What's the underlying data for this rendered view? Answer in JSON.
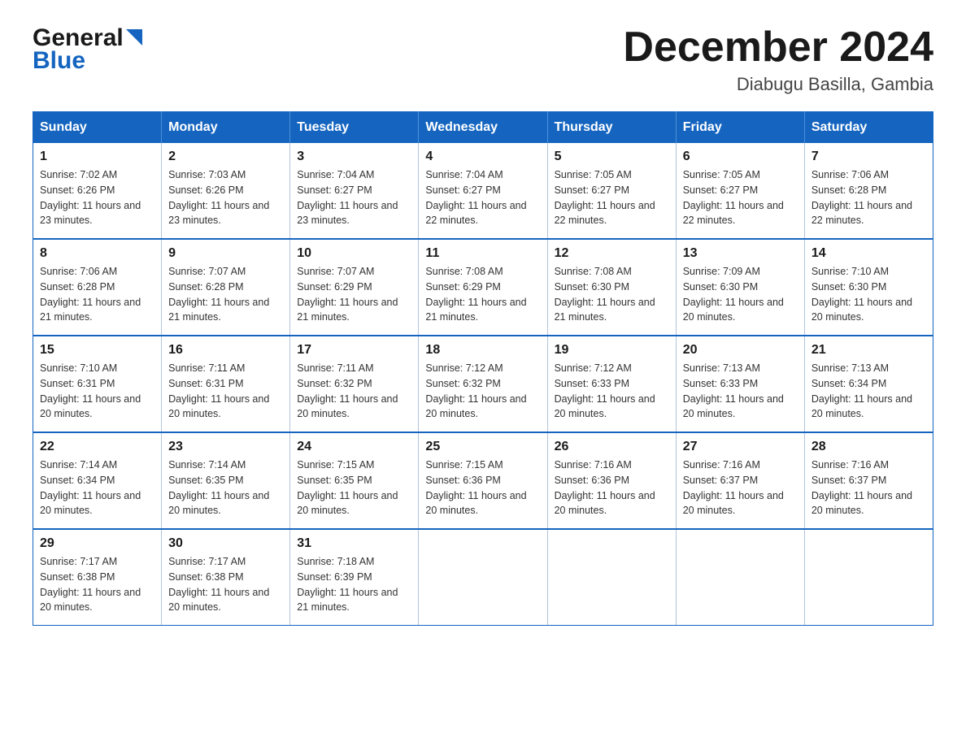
{
  "logo": {
    "general": "General",
    "blue": "Blue"
  },
  "title": "December 2024",
  "location": "Diabugu Basilla, Gambia",
  "headers": [
    "Sunday",
    "Monday",
    "Tuesday",
    "Wednesday",
    "Thursday",
    "Friday",
    "Saturday"
  ],
  "weeks": [
    [
      {
        "day": "1",
        "sunrise": "7:02 AM",
        "sunset": "6:26 PM",
        "daylight": "11 hours and 23 minutes."
      },
      {
        "day": "2",
        "sunrise": "7:03 AM",
        "sunset": "6:26 PM",
        "daylight": "11 hours and 23 minutes."
      },
      {
        "day": "3",
        "sunrise": "7:04 AM",
        "sunset": "6:27 PM",
        "daylight": "11 hours and 23 minutes."
      },
      {
        "day": "4",
        "sunrise": "7:04 AM",
        "sunset": "6:27 PM",
        "daylight": "11 hours and 22 minutes."
      },
      {
        "day": "5",
        "sunrise": "7:05 AM",
        "sunset": "6:27 PM",
        "daylight": "11 hours and 22 minutes."
      },
      {
        "day": "6",
        "sunrise": "7:05 AM",
        "sunset": "6:27 PM",
        "daylight": "11 hours and 22 minutes."
      },
      {
        "day": "7",
        "sunrise": "7:06 AM",
        "sunset": "6:28 PM",
        "daylight": "11 hours and 22 minutes."
      }
    ],
    [
      {
        "day": "8",
        "sunrise": "7:06 AM",
        "sunset": "6:28 PM",
        "daylight": "11 hours and 21 minutes."
      },
      {
        "day": "9",
        "sunrise": "7:07 AM",
        "sunset": "6:28 PM",
        "daylight": "11 hours and 21 minutes."
      },
      {
        "day": "10",
        "sunrise": "7:07 AM",
        "sunset": "6:29 PM",
        "daylight": "11 hours and 21 minutes."
      },
      {
        "day": "11",
        "sunrise": "7:08 AM",
        "sunset": "6:29 PM",
        "daylight": "11 hours and 21 minutes."
      },
      {
        "day": "12",
        "sunrise": "7:08 AM",
        "sunset": "6:30 PM",
        "daylight": "11 hours and 21 minutes."
      },
      {
        "day": "13",
        "sunrise": "7:09 AM",
        "sunset": "6:30 PM",
        "daylight": "11 hours and 20 minutes."
      },
      {
        "day": "14",
        "sunrise": "7:10 AM",
        "sunset": "6:30 PM",
        "daylight": "11 hours and 20 minutes."
      }
    ],
    [
      {
        "day": "15",
        "sunrise": "7:10 AM",
        "sunset": "6:31 PM",
        "daylight": "11 hours and 20 minutes."
      },
      {
        "day": "16",
        "sunrise": "7:11 AM",
        "sunset": "6:31 PM",
        "daylight": "11 hours and 20 minutes."
      },
      {
        "day": "17",
        "sunrise": "7:11 AM",
        "sunset": "6:32 PM",
        "daylight": "11 hours and 20 minutes."
      },
      {
        "day": "18",
        "sunrise": "7:12 AM",
        "sunset": "6:32 PM",
        "daylight": "11 hours and 20 minutes."
      },
      {
        "day": "19",
        "sunrise": "7:12 AM",
        "sunset": "6:33 PM",
        "daylight": "11 hours and 20 minutes."
      },
      {
        "day": "20",
        "sunrise": "7:13 AM",
        "sunset": "6:33 PM",
        "daylight": "11 hours and 20 minutes."
      },
      {
        "day": "21",
        "sunrise": "7:13 AM",
        "sunset": "6:34 PM",
        "daylight": "11 hours and 20 minutes."
      }
    ],
    [
      {
        "day": "22",
        "sunrise": "7:14 AM",
        "sunset": "6:34 PM",
        "daylight": "11 hours and 20 minutes."
      },
      {
        "day": "23",
        "sunrise": "7:14 AM",
        "sunset": "6:35 PM",
        "daylight": "11 hours and 20 minutes."
      },
      {
        "day": "24",
        "sunrise": "7:15 AM",
        "sunset": "6:35 PM",
        "daylight": "11 hours and 20 minutes."
      },
      {
        "day": "25",
        "sunrise": "7:15 AM",
        "sunset": "6:36 PM",
        "daylight": "11 hours and 20 minutes."
      },
      {
        "day": "26",
        "sunrise": "7:16 AM",
        "sunset": "6:36 PM",
        "daylight": "11 hours and 20 minutes."
      },
      {
        "day": "27",
        "sunrise": "7:16 AM",
        "sunset": "6:37 PM",
        "daylight": "11 hours and 20 minutes."
      },
      {
        "day": "28",
        "sunrise": "7:16 AM",
        "sunset": "6:37 PM",
        "daylight": "11 hours and 20 minutes."
      }
    ],
    [
      {
        "day": "29",
        "sunrise": "7:17 AM",
        "sunset": "6:38 PM",
        "daylight": "11 hours and 20 minutes."
      },
      {
        "day": "30",
        "sunrise": "7:17 AM",
        "sunset": "6:38 PM",
        "daylight": "11 hours and 20 minutes."
      },
      {
        "day": "31",
        "sunrise": "7:18 AM",
        "sunset": "6:39 PM",
        "daylight": "11 hours and 21 minutes."
      },
      null,
      null,
      null,
      null
    ]
  ]
}
